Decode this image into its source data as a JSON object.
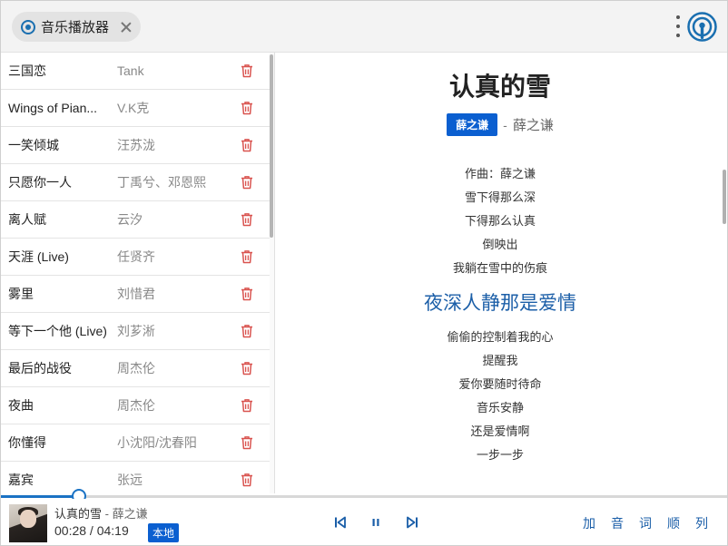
{
  "app": {
    "tab_label": "音乐播放器",
    "accent_color": "#0b5fd0",
    "delete_color": "#d9534f"
  },
  "playlist": [
    {
      "title": "三国恋",
      "artist": "Tank"
    },
    {
      "title": "Wings of Pian...",
      "artist": "V.K克"
    },
    {
      "title": "一笑倾城",
      "artist": "汪苏泷"
    },
    {
      "title": "只愿你一人",
      "artist": "丁禹兮、邓恩熙"
    },
    {
      "title": "离人赋",
      "artist": "云汐"
    },
    {
      "title": "天涯 (Live)",
      "artist": "任贤齐"
    },
    {
      "title": "雾里",
      "artist": "刘惜君"
    },
    {
      "title": "等下一个他 (Live)",
      "artist": "刘芗淅"
    },
    {
      "title": "最后的战役",
      "artist": "周杰伦"
    },
    {
      "title": "夜曲",
      "artist": "周杰伦"
    },
    {
      "title": "你懂得",
      "artist": "小沈阳/沈春阳"
    },
    {
      "title": "嘉宾",
      "artist": "张远"
    }
  ],
  "song": {
    "title": "认真的雪",
    "artist_badge": "薛之谦",
    "separator": "-",
    "artist": "薛之谦"
  },
  "lyrics": [
    "作曲：薛之谦",
    "雪下得那么深",
    "下得那么认真",
    "倒映出",
    "我躺在雪中的伤痕",
    "夜深人静那是爱情",
    "偷偷的控制着我的心",
    "提醒我",
    "爱你要随时待命",
    "音乐安静",
    "还是爱情啊",
    "一步一步"
  ],
  "active_lyric_index": 5,
  "player": {
    "now_title": "认真的雪",
    "now_sep": " - ",
    "now_artist": "薛之谦",
    "current_time": "00:28",
    "time_sep": " / ",
    "total_time": "04:19",
    "source_badge": "本地",
    "progress_fraction": 0.108,
    "icons": {
      "prev": "skip-previous-icon",
      "pause": "pause-icon",
      "next": "skip-next-icon"
    },
    "actions": [
      "加",
      "音",
      "词",
      "顺",
      "列"
    ]
  }
}
